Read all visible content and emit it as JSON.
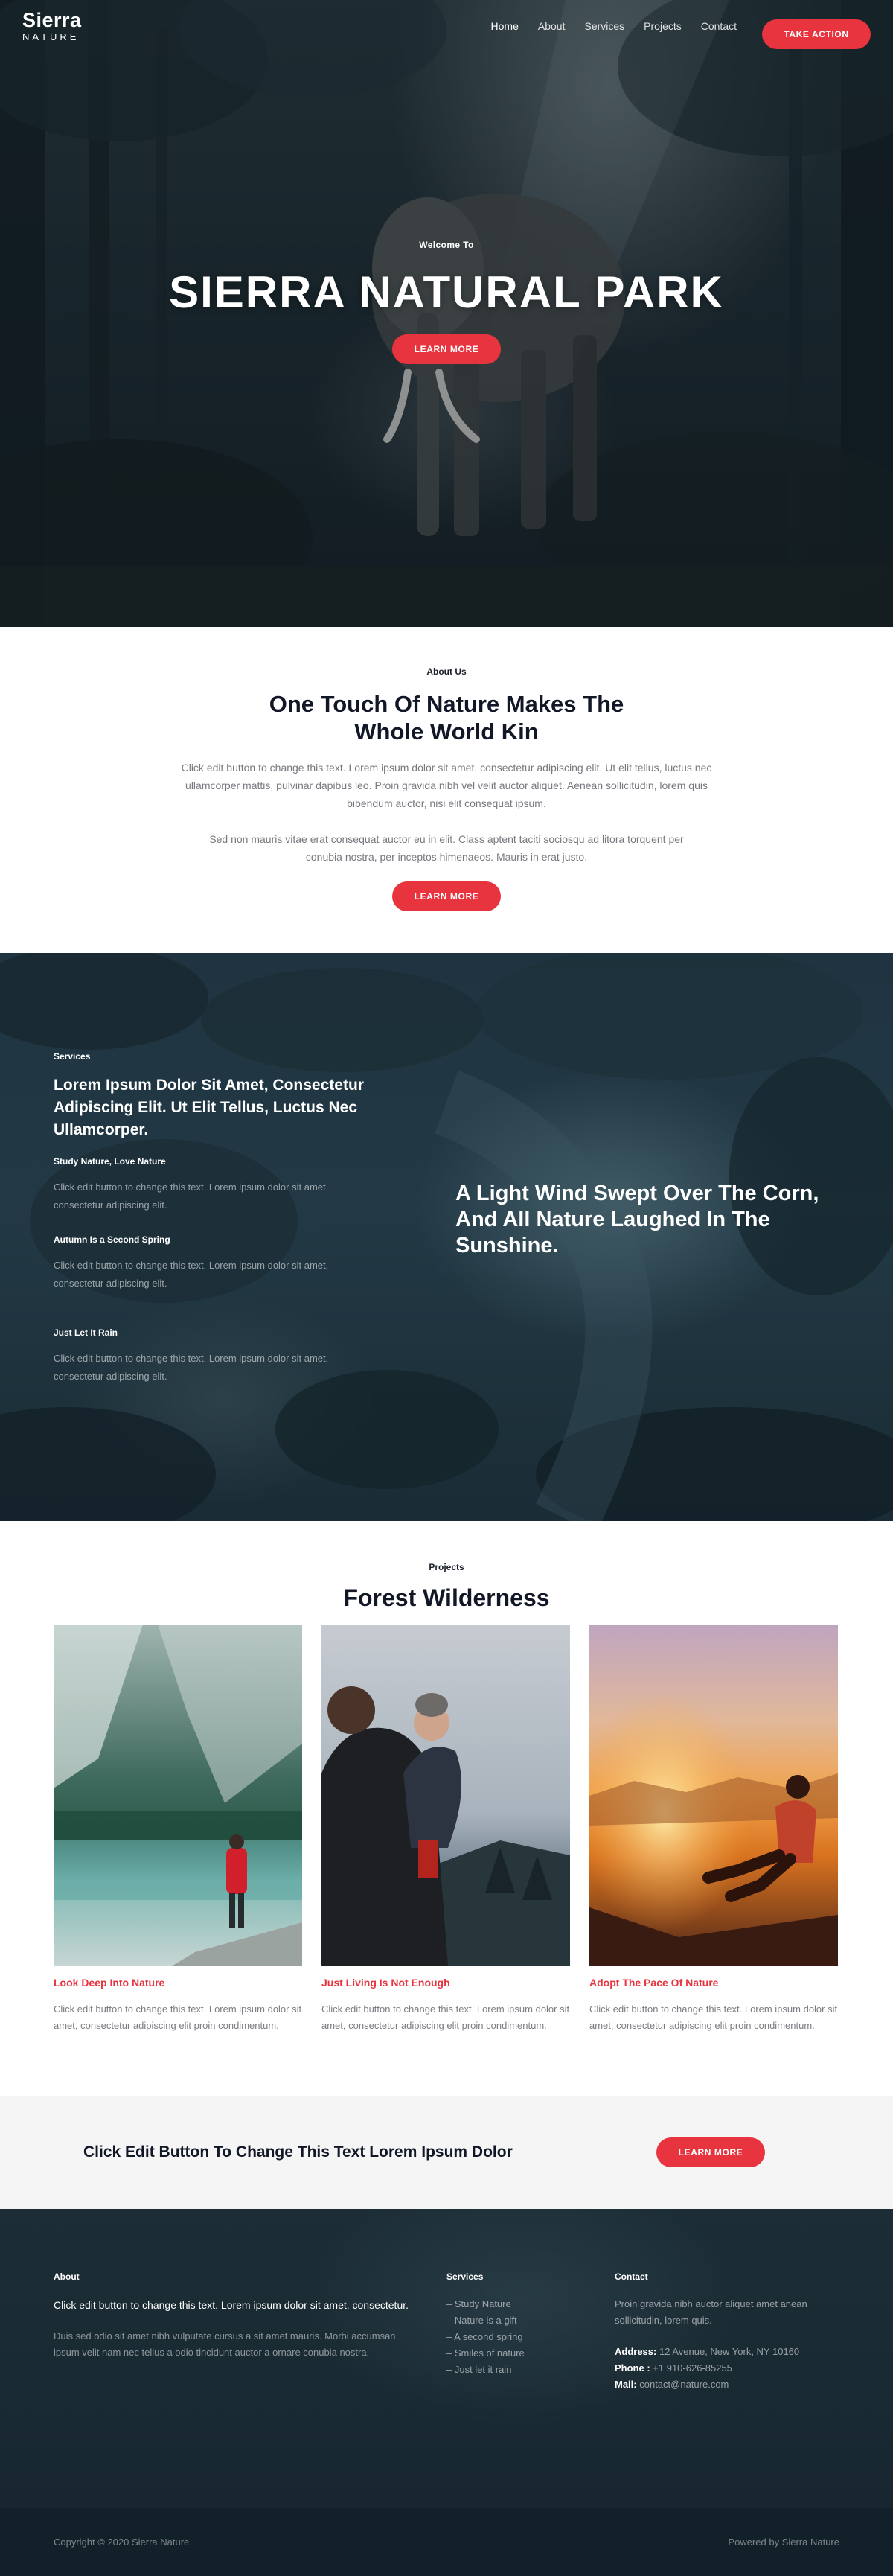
{
  "nav": {
    "logo_line1": "Sierra",
    "logo_line2": "NATURE",
    "items": [
      "Home",
      "About",
      "Services",
      "Projects",
      "Contact"
    ],
    "cta": "TAKE ACTION"
  },
  "hero": {
    "kicker": "Welcome To",
    "title": "SIERRA NATURAL PARK",
    "button": "LEARN MORE"
  },
  "about": {
    "kicker": "About Us",
    "title": "One Touch Of Nature Makes The Whole World Kin",
    "para1": "Click edit button to change this text. Lorem ipsum dolor sit amet, consectetur adipiscing elit. Ut elit tellus, luctus nec ullamcorper mattis, pulvinar dapibus leo. Proin gravida nibh vel velit auctor aliquet. Aenean sollicitudin, lorem quis bibendum auctor, nisi elit consequat ipsum.",
    "para2": "Sed non mauris vitae erat consequat auctor eu in elit. Class aptent taciti sociosqu ad litora torquent per conubia nostra, per inceptos himenaeos. Mauris in erat justo.",
    "button": "LEARN MORE"
  },
  "services": {
    "kicker": "Services",
    "title": "Lorem Ipsum Dolor Sit Amet, Consectetur Adipiscing Elit. Ut Elit Tellus, Luctus Nec Ullamcorper.",
    "items": [
      {
        "title": "Study Nature, Love Nature",
        "text": "Click edit button to change this text. Lorem ipsum dolor sit amet, consectetur adipiscing elit."
      },
      {
        "title": "Autumn Is a Second Spring",
        "text": "Click edit button to change this text. Lorem ipsum dolor sit amet, consectetur adipiscing elit."
      },
      {
        "title": "Just Let It Rain",
        "text": "Click edit button to change this text. Lorem ipsum dolor sit amet, consectetur adipiscing elit."
      }
    ],
    "quote": "A Light Wind Swept Over The Corn, And All Nature Laughed In The Sunshine."
  },
  "projects": {
    "kicker": "Projects",
    "title": "Forest Wilderness",
    "cards": [
      {
        "title": "Look Deep Into Nature",
        "text": "Click edit button to change this text. Lorem ipsum dolor sit amet, consectetur adipiscing elit proin condimentum."
      },
      {
        "title": "Just Living Is Not Enough",
        "text": "Click edit button to change this text. Lorem ipsum dolor sit amet, consectetur adipiscing elit proin condimentum."
      },
      {
        "title": "Adopt The Pace Of Nature",
        "text": "Click edit button to change this text. Lorem ipsum dolor sit amet, consectetur adipiscing elit proin condimentum."
      }
    ]
  },
  "cta": {
    "text": "Click Edit Button To Change This Text Lorem Ipsum Dolor",
    "button": "LEARN MORE"
  },
  "footer": {
    "about": {
      "heading": "About",
      "lead": "Click edit button to change this text. Lorem ipsum dolor sit amet, consectetur.",
      "sub": "Duis sed odio sit amet nibh vulputate cursus a sit amet mauris. Morbi accumsan ipsum velit nam nec tellus a odio tincidunt auctor a ornare conubia nostra."
    },
    "services": {
      "heading": "Services",
      "items": [
        "– Study Nature",
        "– Nature is a gift",
        "– A second spring",
        "– Smiles of nature",
        "– Just let it rain"
      ]
    },
    "contact": {
      "heading": "Contact",
      "lead": "Proin gravida nibh auctor aliquet amet anean sollicitudin, lorem quis.",
      "address_label": "Address:",
      "address": " 12 Avenue, New York, NY 10160",
      "phone_label": "Phone :",
      "phone": " +1 910-626-85255",
      "mail_label": "Mail:",
      "mail": " contact@nature.com"
    },
    "copyright": "Copyright © 2020 Sierra Nature",
    "powered": "Powered by Sierra Nature"
  },
  "colors": {
    "accent": "#e8343f",
    "dark_bg": "#1c2d35",
    "text_muted": "#77797f"
  }
}
